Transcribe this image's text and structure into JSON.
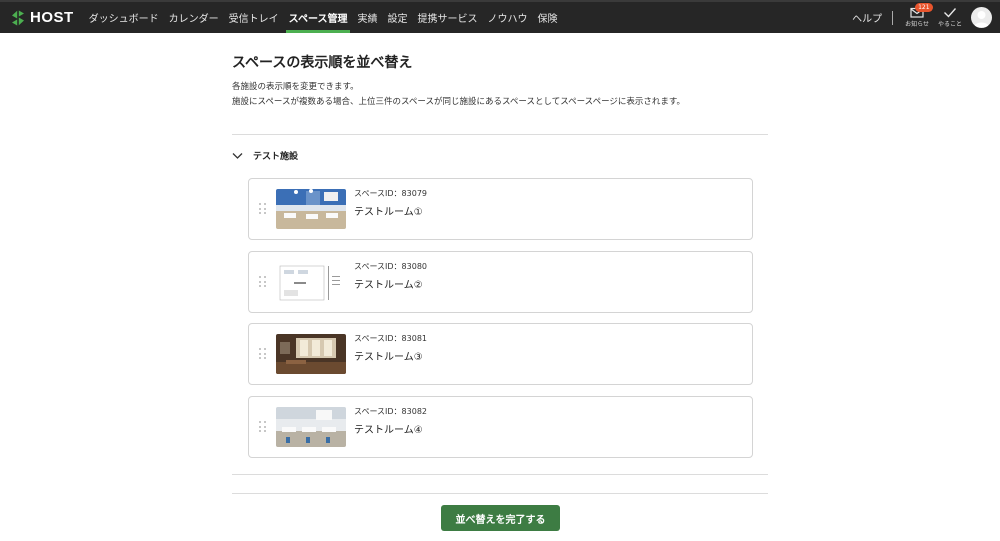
{
  "header": {
    "brand": "HOST",
    "nav": [
      {
        "label": "ダッシュボード",
        "active": false
      },
      {
        "label": "カレンダー",
        "active": false
      },
      {
        "label": "受信トレイ",
        "active": false
      },
      {
        "label": "スペース管理",
        "active": true
      },
      {
        "label": "実績",
        "active": false
      },
      {
        "label": "設定",
        "active": false
      },
      {
        "label": "提携サービス",
        "active": false
      },
      {
        "label": "ノウハウ",
        "active": false
      },
      {
        "label": "保険",
        "active": false
      }
    ],
    "help_label": "ヘルプ",
    "notifications_label": "お知らせ",
    "notifications_count": "121",
    "todo_label": "やること"
  },
  "page": {
    "title": "スペースの表示順を並べ替え",
    "description_line1": "各施設の表示順を変更できます。",
    "description_line2": "施設にスペースが複数ある場合、上位三件のスペースが同じ施設にあるスペースとしてスペースページに表示されます。"
  },
  "facility": {
    "name": "テスト施設",
    "spaces": [
      {
        "id_label": "スペースID：83079",
        "name": "テストルーム①"
      },
      {
        "id_label": "スペースID：83080",
        "name": "テストルーム②"
      },
      {
        "id_label": "スペースID：83081",
        "name": "テストルーム③"
      },
      {
        "id_label": "スペースID：83082",
        "name": "テストルーム④"
      }
    ]
  },
  "actions": {
    "done_label": "並べ替えを完了する"
  },
  "colors": {
    "header_bg": "#262626",
    "accent_green": "#4caf50",
    "button_green": "#3d7c43",
    "badge": "#e8542c"
  }
}
